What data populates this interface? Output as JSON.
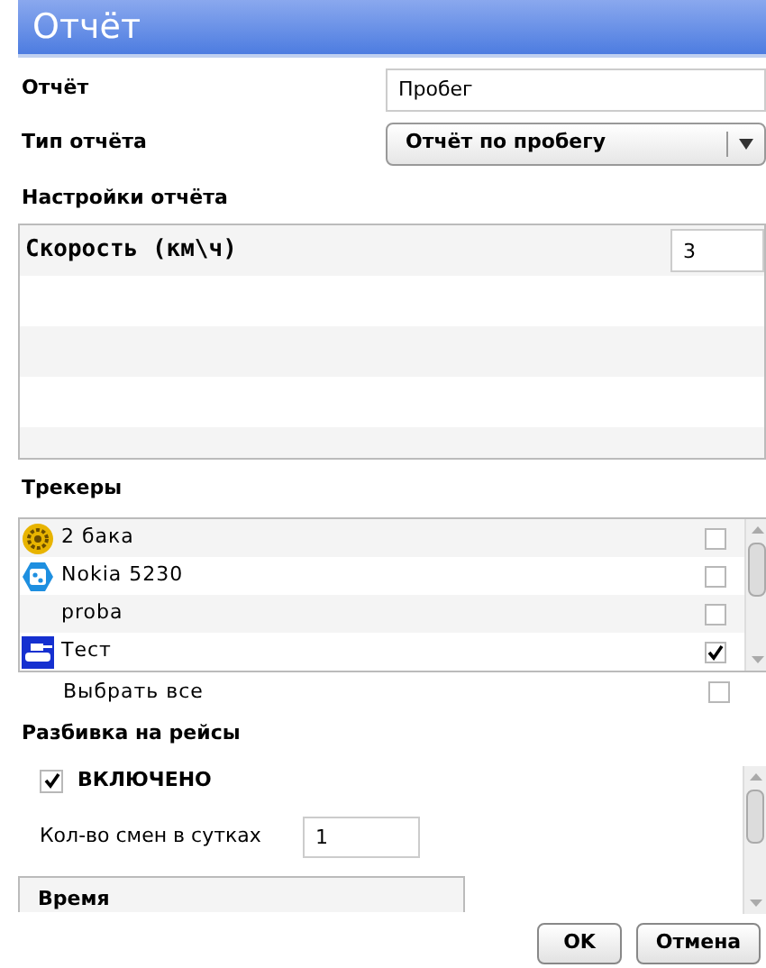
{
  "window": {
    "title": "Отчёт"
  },
  "report": {
    "label": "Отчёт",
    "value": "Пробег"
  },
  "report_type": {
    "label": "Тип отчёта",
    "value": "Отчёт по пробегу"
  },
  "settings": {
    "title": "Настройки отчёта",
    "field_label": "Скорость (км\\ч)",
    "field_value": "3"
  },
  "trackers": {
    "title": "Трекеры",
    "items": [
      {
        "name": "2 бака",
        "kind": "gear",
        "checked": false
      },
      {
        "name": "Nokia 5230",
        "kind": "phone",
        "checked": false
      },
      {
        "name": "proba",
        "kind": "plain",
        "checked": false
      },
      {
        "name": "Тест",
        "kind": "tank",
        "checked": true
      }
    ],
    "select_all": {
      "label": "Выбрать все",
      "checked": false
    }
  },
  "trips": {
    "title": "Разбивка на рейсы",
    "enabled": {
      "label": "ВКЛЮЧЕНО",
      "checked": true
    },
    "shifts_label": "Кол-во смен в сутках",
    "shifts_value": "1",
    "time_header": "Время"
  },
  "buttons": [
    {
      "label": "OK"
    },
    {
      "label": "Отмена"
    }
  ]
}
